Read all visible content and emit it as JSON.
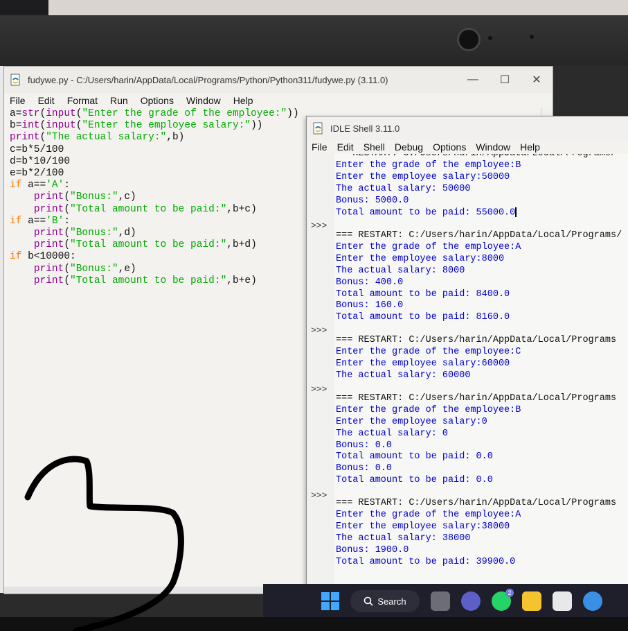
{
  "editor": {
    "title": "fudywe.py - C:/Users/harin/AppData/Local/Programs/Python/Python311/fudywe.py (3.11.0)",
    "menu": [
      "File",
      "Edit",
      "Format",
      "Run",
      "Options",
      "Window",
      "Help"
    ],
    "code": [
      "a=str(input(\"Enter the grade of the employee:\"))",
      "b=int(input(\"Enter the employee salary:\"))",
      "print(\"The actual salary:\",b)",
      "c=b*5/100",
      "d=b*10/100",
      "e=b*2/100",
      "if a=='A':",
      "    print(\"Bonus:\",c)",
      "    print(\"Total amount to be paid:\",b+c)",
      "if a=='B':",
      "    print(\"Bonus:\",d)",
      "    print(\"Total amount to be paid:\",b+d)",
      "if b<10000:",
      "    print(\"Bonus:\",e)",
      "    print(\"Total amount to be paid:\",b+e)"
    ]
  },
  "shell": {
    "title": "IDLE Shell 3.11.0",
    "menu": [
      "File",
      "Edit",
      "Shell",
      "Debug",
      "Options",
      "Window",
      "Help"
    ],
    "prompt": ">>>",
    "blocks": [
      {
        "restart": "== RESTART: C:/Users/harin/AppData/Local/Programs/",
        "lines": [
          "Enter the grade of the employee:B",
          "Enter the employee salary:50000",
          "The actual salary: 50000",
          "Bonus: 5000.0",
          "Total amount to be paid: 55000.0"
        ]
      },
      {
        "restart": "=== RESTART: C:/Users/harin/AppData/Local/Programs/",
        "lines": [
          "Enter the grade of the employee:A",
          "Enter the employee salary:8000",
          "The actual salary: 8000",
          "Bonus: 400.0",
          "Total amount to be paid: 8400.0",
          "Bonus: 160.0",
          "Total amount to be paid: 8160.0"
        ]
      },
      {
        "restart": "=== RESTART: C:/Users/harin/AppData/Local/Programs",
        "lines": [
          "Enter the grade of the employee:C",
          "Enter the employee salary:60000",
          "The actual salary: 60000"
        ]
      },
      {
        "restart": "=== RESTART: C:/Users/harin/AppData/Local/Programs",
        "lines": [
          "Enter the grade of the employee:B",
          "Enter the employee salary:0",
          "The actual salary: 0",
          "Bonus: 0.0",
          "Total amount to be paid: 0.0",
          "Bonus: 0.0",
          "Total amount to be paid: 0.0"
        ]
      },
      {
        "restart": "=== RESTART: C:/Users/harin/AppData/Local/Programs",
        "lines": [
          "Enter the grade of the employee:A",
          "Enter the employee salary:38000",
          "The actual salary: 38000",
          "Bonus: 1900.0",
          "Total amount to be paid: 39900.0"
        ]
      }
    ]
  },
  "taskbar": {
    "search_label": "Search",
    "whatsapp_badge": "2",
    "icons": [
      "windows-start-icon",
      "search-icon",
      "task-view-icon",
      "teams-icon",
      "whatsapp-icon",
      "file-explorer-icon",
      "store-icon",
      "settings-icon"
    ]
  }
}
